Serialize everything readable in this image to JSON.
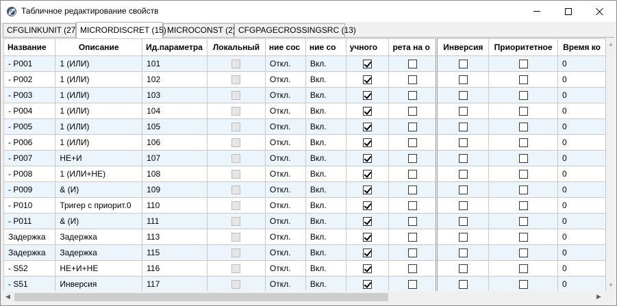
{
  "window": {
    "title": "Табличное редактирование свойств",
    "minimize_icon": "minimize-icon",
    "maximize_icon": "maximize-icon",
    "close_icon": "close-icon"
  },
  "tabs": [
    {
      "label": "CFGLINKUNIT (27)",
      "active": false
    },
    {
      "label": "MICRORDISCRET (15)",
      "active": true
    },
    {
      "label": "MICROCONST (2)",
      "active": false
    },
    {
      "label": "CFGPAGECROSSINGSRC (13)",
      "active": false
    }
  ],
  "grid": {
    "columns": [
      "Название",
      "Описание",
      "Ид.параметра",
      "Локальный",
      "ние сос",
      "ние со",
      "учного",
      "рета на о",
      "Инверсия",
      "Приоритетное",
      "Время ко"
    ],
    "rows": [
      {
        "name": "- P001",
        "desc": "1 (ИЛИ)",
        "id": "101",
        "off": "Откл.",
        "on": "Вкл.",
        "manual": true,
        "prohibit": false,
        "inversion": false,
        "priority": false,
        "time": "0"
      },
      {
        "name": "- P002",
        "desc": "1 (ИЛИ)",
        "id": "102",
        "off": "Откл.",
        "on": "Вкл.",
        "manual": true,
        "prohibit": false,
        "inversion": false,
        "priority": false,
        "time": "0"
      },
      {
        "name": "- P003",
        "desc": "1 (ИЛИ)",
        "id": "103",
        "off": "Откл.",
        "on": "Вкл.",
        "manual": true,
        "prohibit": false,
        "inversion": false,
        "priority": false,
        "time": "0"
      },
      {
        "name": "- P004",
        "desc": "1 (ИЛИ)",
        "id": "104",
        "off": "Откл.",
        "on": "Вкл.",
        "manual": true,
        "prohibit": false,
        "inversion": false,
        "priority": false,
        "time": "0"
      },
      {
        "name": "- P005",
        "desc": "1 (ИЛИ)",
        "id": "105",
        "off": "Откл.",
        "on": "Вкл.",
        "manual": true,
        "prohibit": false,
        "inversion": false,
        "priority": false,
        "time": "0"
      },
      {
        "name": "- P006",
        "desc": "1 (ИЛИ)",
        "id": "106",
        "off": "Откл.",
        "on": "Вкл.",
        "manual": true,
        "prohibit": false,
        "inversion": false,
        "priority": false,
        "time": "0"
      },
      {
        "name": "- P007",
        "desc": "НЕ+И",
        "id": "107",
        "off": "Откл.",
        "on": "Вкл.",
        "manual": true,
        "prohibit": false,
        "inversion": false,
        "priority": false,
        "time": "0"
      },
      {
        "name": "- P008",
        "desc": "1 (ИЛИ+НЕ)",
        "id": "108",
        "off": "Откл.",
        "on": "Вкл.",
        "manual": true,
        "prohibit": false,
        "inversion": false,
        "priority": false,
        "time": "0"
      },
      {
        "name": "- P009",
        "desc": "& (И)",
        "id": "109",
        "off": "Откл.",
        "on": "Вкл.",
        "manual": true,
        "prohibit": false,
        "inversion": false,
        "priority": false,
        "time": "0"
      },
      {
        "name": "- P010",
        "desc": "Тригер с приорит.0",
        "id": "110",
        "off": "Откл.",
        "on": "Вкл.",
        "manual": true,
        "prohibit": false,
        "inversion": false,
        "priority": false,
        "time": "0"
      },
      {
        "name": "- P011",
        "desc": "& (И)",
        "id": "111",
        "off": "Откл.",
        "on": "Вкл.",
        "manual": true,
        "prohibit": false,
        "inversion": false,
        "priority": false,
        "time": "0"
      },
      {
        "name": "Задержка",
        "desc": "Задержка",
        "id": "113",
        "off": "Откл.",
        "on": "Вкл.",
        "manual": true,
        "prohibit": false,
        "inversion": false,
        "priority": false,
        "time": "0"
      },
      {
        "name": "Задержка",
        "desc": "Задержка",
        "id": "115",
        "off": "Откл.",
        "on": "Вкл.",
        "manual": true,
        "prohibit": false,
        "inversion": false,
        "priority": false,
        "time": "0"
      },
      {
        "name": "- S52",
        "desc": "НЕ+И+НЕ",
        "id": "116",
        "off": "Откл.",
        "on": "Вкл.",
        "manual": true,
        "prohibit": false,
        "inversion": false,
        "priority": false,
        "time": "0"
      },
      {
        "name": "- S51",
        "desc": "Инверсия",
        "id": "117",
        "off": "Откл.",
        "on": "Вкл.",
        "manual": true,
        "prohibit": false,
        "inversion": false,
        "priority": false,
        "time": "0"
      }
    ]
  }
}
